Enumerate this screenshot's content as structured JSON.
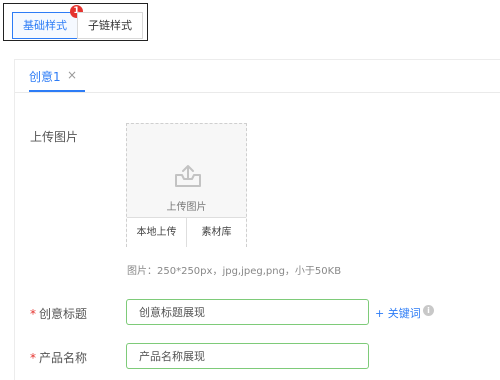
{
  "style_tabs": {
    "basic_label": "基础样式",
    "basic_badge": "1",
    "sub_label": "子链样式"
  },
  "creative_tabs": [
    {
      "label": "创意1",
      "close": "×"
    }
  ],
  "form": {
    "upload": {
      "label": "上传图片",
      "box_text": "上传图片",
      "local_upload": "本地上传",
      "library": "素材库",
      "hint": "图片：250*250px，jpg,jpeg,png，小于50KB",
      "icon": "upload-tray-icon"
    },
    "title_field": {
      "required_mark": "*",
      "label": "创意标题",
      "value": "创意标题展现",
      "keyword_link": "+ 关键词",
      "info_icon": "i"
    },
    "product_field": {
      "required_mark": "*",
      "label": "产品名称",
      "value": "产品名称展现"
    }
  },
  "colors": {
    "accent": "#2d7cf6",
    "badge": "#e5342f",
    "input_border": "#7ecb79",
    "required": "#e5342f"
  }
}
